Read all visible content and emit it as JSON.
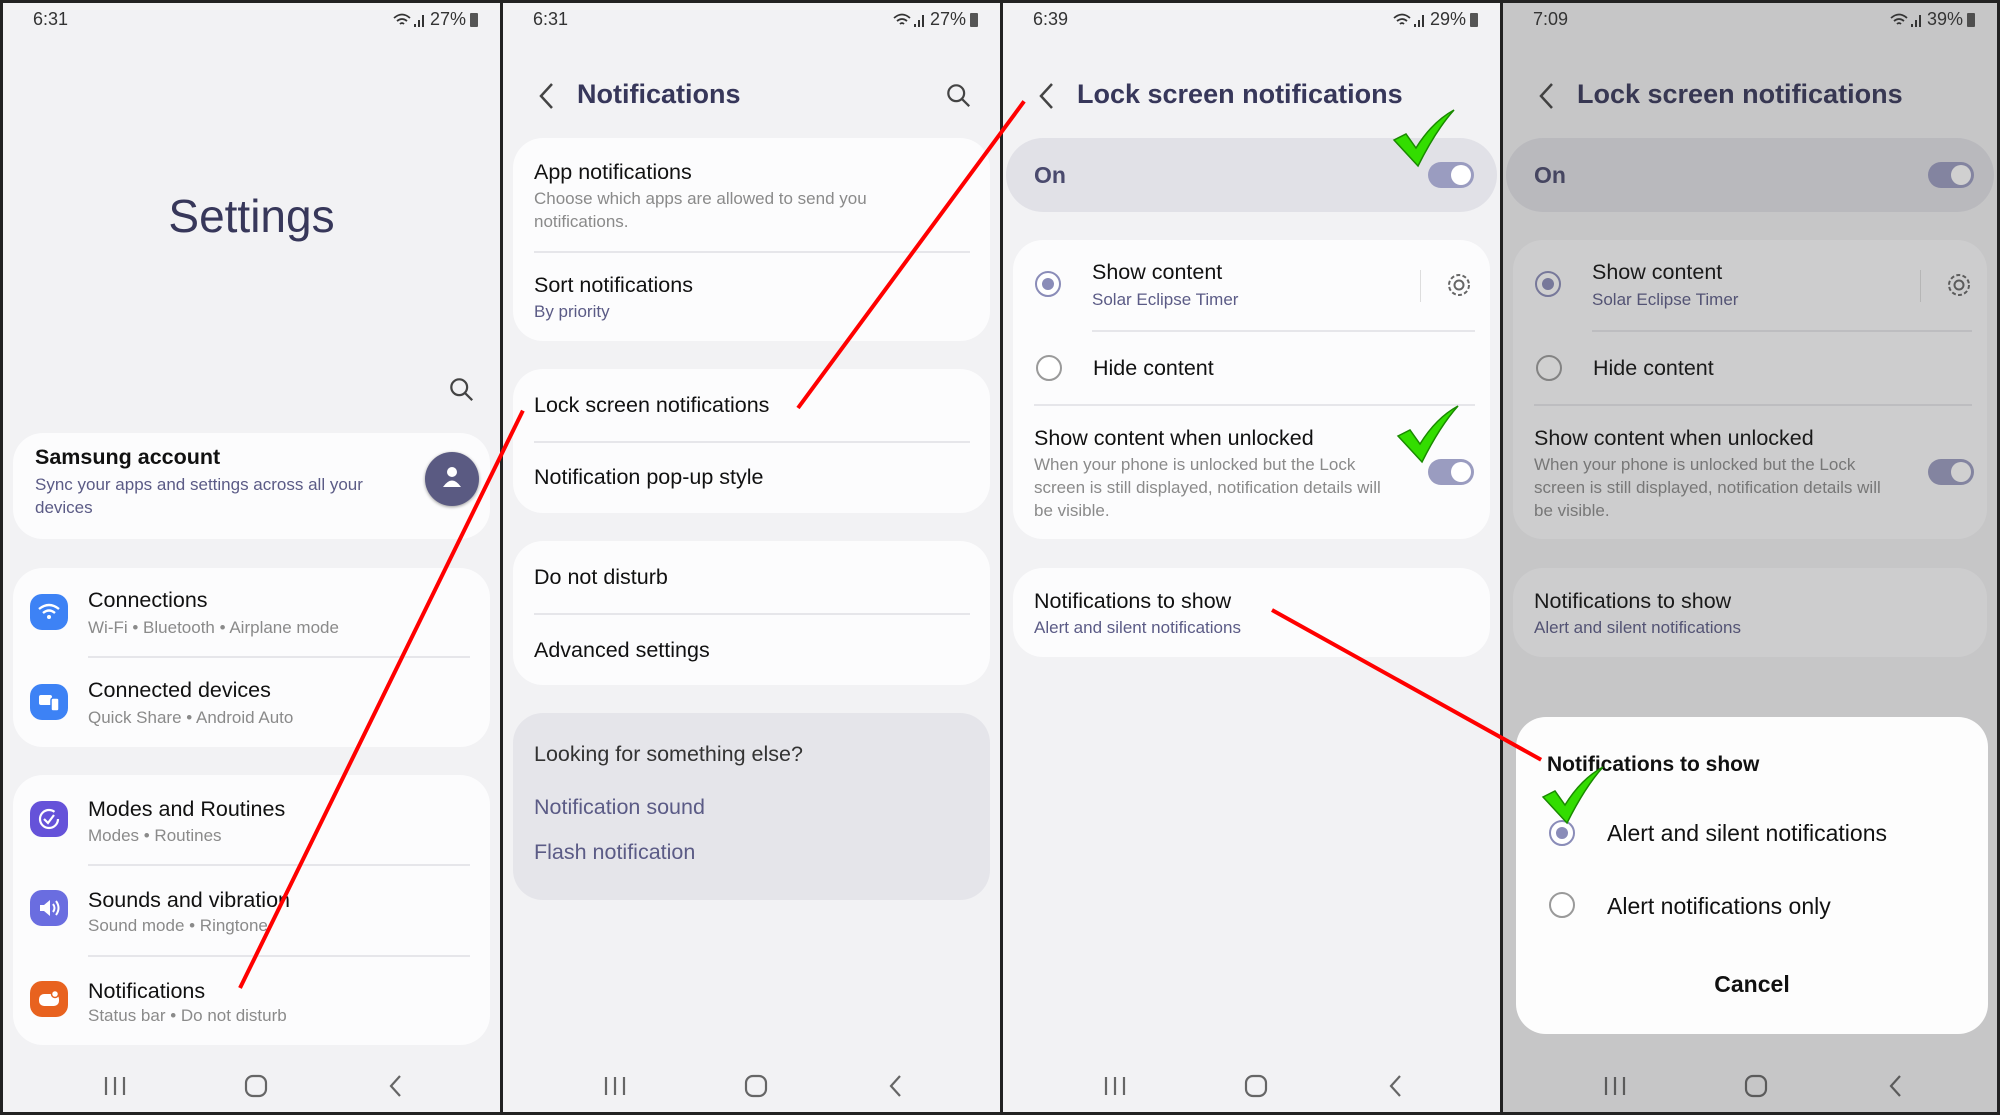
{
  "screen1": {
    "status": {
      "time": "6:31",
      "battery": "27%"
    },
    "title": "Settings",
    "account": {
      "title": "Samsung account",
      "subtitle_line1": "Sync your apps and settings across all your",
      "subtitle_line2": "devices"
    },
    "items": [
      {
        "title": "Connections",
        "subtitle": "Wi-Fi  •  Bluetooth  •  Airplane mode",
        "icon": "wifi-icon",
        "color": "#3d82f5"
      },
      {
        "title": "Connected devices",
        "subtitle": "Quick Share  •  Android Auto",
        "icon": "connected-devices-icon",
        "color": "#3d82f5"
      },
      {
        "title": "Modes and Routines",
        "subtitle": "Modes  •  Routines",
        "icon": "modes-routines-icon",
        "color": "#6552d9"
      },
      {
        "title": "Sounds and vibration",
        "subtitle": "Sound mode  •  Ringtone",
        "icon": "sound-icon",
        "color": "#6a6de0"
      },
      {
        "title": "Notifications",
        "subtitle": "Status bar  •  Do not disturb",
        "icon": "notifications-icon",
        "color": "#e8621f"
      }
    ]
  },
  "screen2": {
    "status": {
      "time": "6:31",
      "battery": "27%"
    },
    "title": "Notifications",
    "app_notifications": {
      "title": "App notifications",
      "line1": "Choose which apps are allowed to send you",
      "line2": "notifications."
    },
    "sort": {
      "title": "Sort notifications",
      "subtitle": "By priority"
    },
    "lock_screen": "Lock screen notifications",
    "popup": "Notification pop-up style",
    "dnd": "Do not disturb",
    "advanced": "Advanced settings",
    "looking": {
      "title": "Looking for something else?",
      "link1": "Notification sound",
      "link2": "Flash notification"
    }
  },
  "screen3": {
    "status": {
      "time": "6:39",
      "battery": "29%"
    },
    "title": "Lock screen notifications",
    "master_label": "On",
    "master_on": true,
    "show_content": {
      "title": "Show content",
      "subtitle": "Solar Eclipse Timer",
      "selected": true
    },
    "hide_content": {
      "title": "Hide content",
      "selected": false
    },
    "unlocked": {
      "title": "Show content when unlocked",
      "line1": "When your phone is unlocked but the Lock",
      "line2": "screen is still displayed, notification details will",
      "line3": "be visible.",
      "on": true
    },
    "to_show": {
      "title": "Notifications to show",
      "subtitle": "Alert and silent notifications"
    }
  },
  "screen4": {
    "status": {
      "time": "7:09",
      "battery": "39%"
    },
    "dialog": {
      "title": "Notifications to show",
      "option1": "Alert and silent notifications",
      "option2": "Alert notifications only",
      "selected": "option1",
      "cancel": "Cancel"
    }
  },
  "colors": {
    "accent": "#5b5b86",
    "toggle": "#9a9cc0",
    "annotation_line": "#ff0000",
    "annotation_check": "#33dd00"
  }
}
